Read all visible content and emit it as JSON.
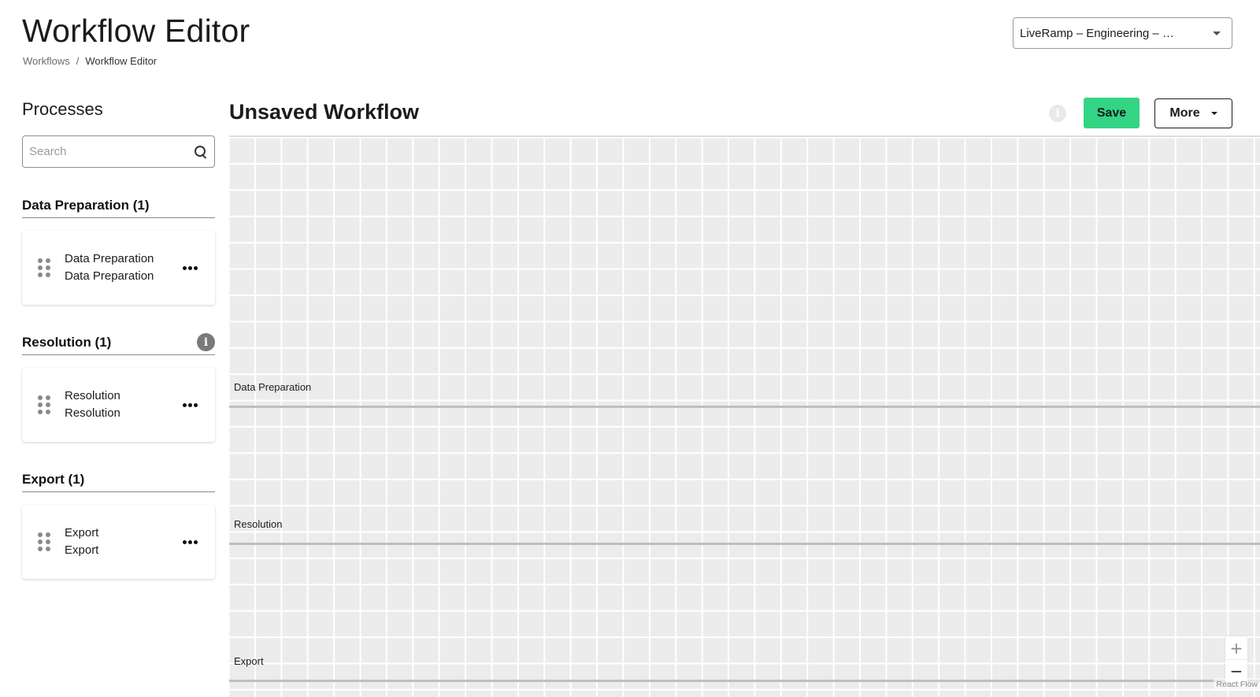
{
  "header": {
    "title": "Workflow Editor",
    "breadcrumb": [
      {
        "label": "Workflows"
      },
      {
        "label": "Workflow Editor"
      }
    ],
    "breadcrumb_separator": "/",
    "org_selector": {
      "value": "LiveRamp – Engineering – …",
      "icon": "caret-down-icon"
    }
  },
  "sidebar": {
    "title": "Processes",
    "search": {
      "placeholder": "Search",
      "value": "",
      "icon": "search-icon"
    },
    "groups": [
      {
        "title": "Data Preparation (1)",
        "has_info": false,
        "items": [
          {
            "line1": "Data Preparation",
            "line2": "Data Preparation"
          }
        ]
      },
      {
        "title": "Resolution (1)",
        "has_info": true,
        "info_glyph": "i",
        "items": [
          {
            "line1": "Resolution",
            "line2": "Resolution"
          }
        ]
      },
      {
        "title": "Export (1)",
        "has_info": false,
        "items": [
          {
            "line1": "Export",
            "line2": "Export"
          }
        ]
      }
    ]
  },
  "canvas": {
    "title": "Unsaved Workflow",
    "info_glyph": "i",
    "save_label": "Save",
    "more_label": "More",
    "accent_color": "#33d584",
    "lanes": [
      {
        "label": "Data Preparation"
      },
      {
        "label": "Resolution"
      },
      {
        "label": "Export"
      }
    ],
    "zoom_in": "+",
    "zoom_out": "−",
    "attribution": "React Flow"
  }
}
